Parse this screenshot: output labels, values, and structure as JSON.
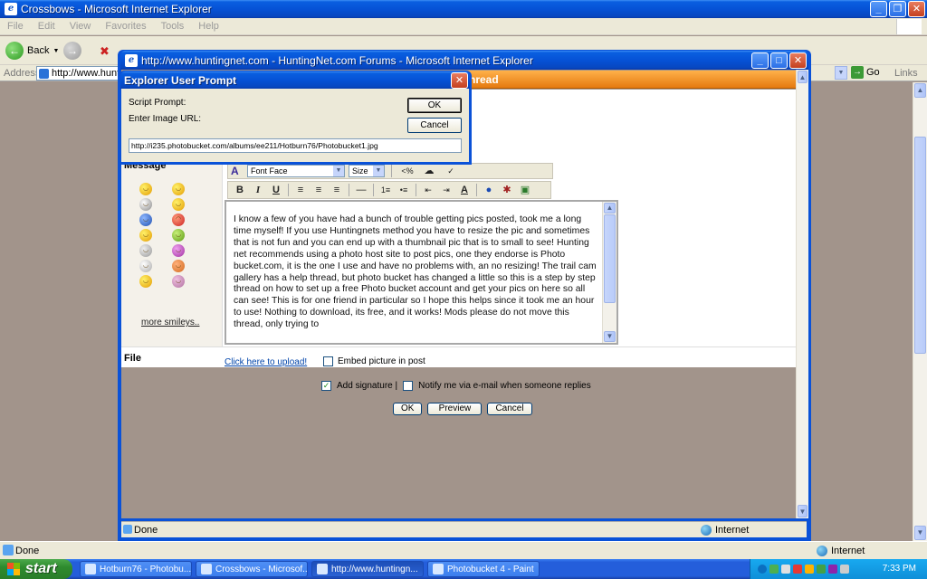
{
  "outer": {
    "title": "Crossbows - Microsoft Internet Explorer",
    "menu": [
      "File",
      "Edit",
      "View",
      "Favorites",
      "Tools",
      "Help"
    ],
    "back_label": "Back",
    "address_label": "Address",
    "address_value": "http://www.huntin",
    "go_label": "Go",
    "links_label": "Links",
    "status_text": "Done",
    "zone_text": "Internet"
  },
  "inner": {
    "title": "http://www.huntingnet.com - HuntingNet.com Forums - Microsoft Internet Explorer",
    "header_text": "hread",
    "message_label": "Message",
    "more_smileys": "more smileys..",
    "font_face": "Font Face",
    "size_label": "Size",
    "message_text": "I know a few of you have had a bunch of trouble getting pics posted, took me a long time myself!  If you use Huntingnets method you have to resize the pic and sometimes that is not fun and you can end up with a thumbnail pic that is to small to see!  Hunting net recommends using a photo host site to post pics, one they endorse is Photo bucket.com, it is the one I use and have no problems with, an no resizing!  The trail cam gallery has a help thread, but photo bucket has changed a little so this is a step by step thread on how to set up a free Photo bucket account and get your pics on here so all can see!  This is for one friend in particular so I hope this helps since it took me an hour to use!  Nothing to download, its free, and it works!  Mods please do not move this thread, only trying to",
    "file_label": "File",
    "upload_link": "Click here to upload!",
    "embed_label": "Embed picture in post",
    "add_signature": "Add signature |",
    "notify_label": "Notify me via e-mail when someone replies",
    "ok_label": "OK",
    "preview_label": "Preview",
    "cancel_label": "Cancel",
    "status_text": "Done",
    "zone_text": "Internet"
  },
  "dialog": {
    "title": "Explorer User Prompt",
    "script_prompt": "Script Prompt:",
    "enter_image_url": "Enter Image URL:",
    "ok_label": "OK",
    "cancel_label": "Cancel",
    "url_value": "http://i235.photobucket.com/albums/ee211/Hotburn76/Photobucket1.jpg"
  },
  "taskbar": {
    "start_label": "start",
    "tasks": [
      "Hotburn76 - Photobu...",
      "Crossbows - Microsof...",
      "http://www.huntingn...",
      "Photobucket 4 - Paint"
    ],
    "clock": "7:33 PM"
  },
  "colors": {
    "title_blue": "#0a52d8",
    "page_brown": "#a2948b",
    "header_orange": "#e57a10",
    "taskbar_blue": "#245edb",
    "start_green": "#2e8b2e"
  }
}
